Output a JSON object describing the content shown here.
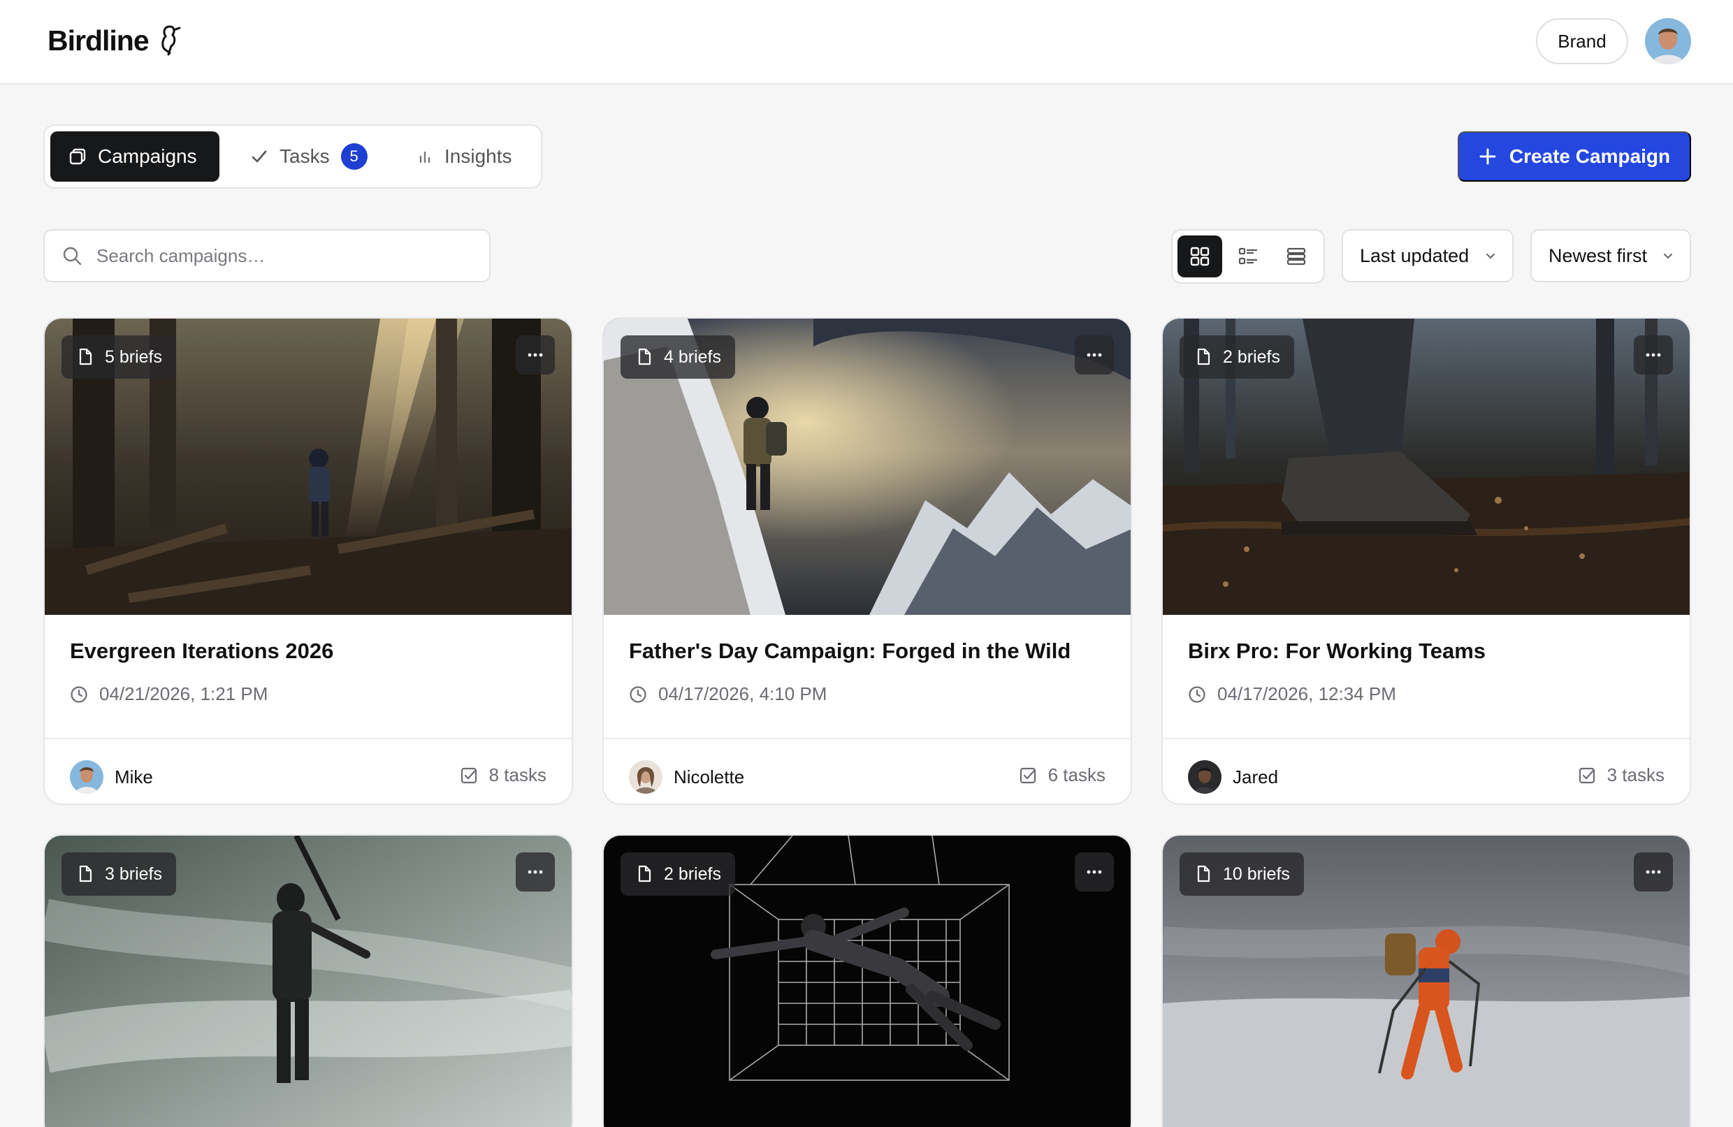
{
  "app": {
    "name": "Birdline"
  },
  "header": {
    "brand_label": "Brand"
  },
  "tabs": [
    {
      "label": "Campaigns",
      "active": true
    },
    {
      "label": "Tasks",
      "badge": "5",
      "active": false
    },
    {
      "label": "Insights",
      "active": false
    }
  ],
  "actions": {
    "create_label": "Create Campaign"
  },
  "search": {
    "placeholder": "Search campaigns…",
    "value": ""
  },
  "view_modes": {
    "selected": "grid",
    "options": [
      "grid-icon",
      "list-detail-icon",
      "rows-icon"
    ]
  },
  "sort": {
    "field": "Last updated",
    "order": "Newest first"
  },
  "colors": {
    "accent": "#2447e0",
    "dark": "#17181a",
    "badge": "#1f3fd1"
  },
  "campaigns": [
    {
      "briefs": "5 briefs",
      "title": "Evergreen Iterations 2026",
      "date": "04/21/2026, 1:21 PM",
      "owner": "Mike",
      "tasks": "8 tasks"
    },
    {
      "briefs": "4 briefs",
      "title": "Father's Day Campaign: Forged in the Wild",
      "date": "04/17/2026, 4:10 PM",
      "owner": "Nicolette",
      "tasks": "6 tasks"
    },
    {
      "briefs": "2 briefs",
      "title": "Birx Pro: For Working Teams",
      "date": "04/17/2026, 12:34 PM",
      "owner": "Jared",
      "tasks": "3 tasks"
    },
    {
      "briefs": "3 briefs"
    },
    {
      "briefs": "2 briefs"
    },
    {
      "briefs": "10 briefs"
    }
  ]
}
